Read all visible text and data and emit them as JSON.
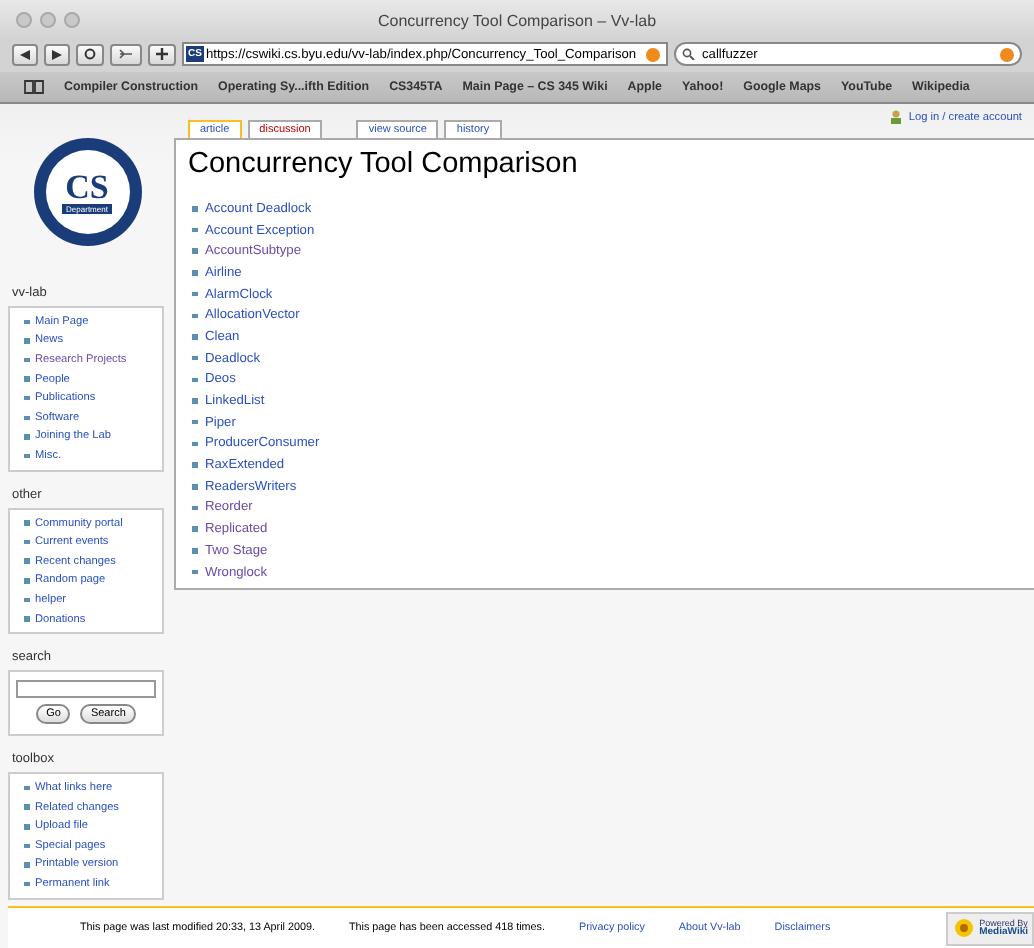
{
  "window": {
    "title": "Concurrency Tool Comparison – Vv-lab"
  },
  "toolbar": {
    "favicon": "CS",
    "address": "https://cswiki.cs.byu.edu/vv-lab/index.php/Concurrency_Tool_Comparison",
    "search": "callfuzzer"
  },
  "bookmarks": [
    "Compiler Construction",
    "Operating Sy...ifth Edition",
    "CS345TA",
    "Main Page – CS 345 Wiki",
    "Apple",
    "Yahoo!",
    "Google Maps",
    "YouTube",
    "Wikipedia"
  ],
  "user_link": "Log in / create account",
  "logo": {
    "text": "CS",
    "subtitle": "Department"
  },
  "tabs": [
    {
      "label": "article",
      "selected": true,
      "missing": false
    },
    {
      "label": "discussion",
      "selected": false,
      "missing": true
    },
    {
      "label": "view source",
      "selected": false,
      "missing": false
    },
    {
      "label": "history",
      "selected": false,
      "missing": false
    }
  ],
  "heading": "Concurrency Tool Comparison",
  "links": [
    {
      "label": "Account Deadlock",
      "visited": false
    },
    {
      "label": "Account Exception",
      "visited": false
    },
    {
      "label": "AccountSubtype",
      "visited": true
    },
    {
      "label": "Airline",
      "visited": false
    },
    {
      "label": "AlarmClock",
      "visited": false
    },
    {
      "label": "AllocationVector",
      "visited": false
    },
    {
      "label": "Clean",
      "visited": false
    },
    {
      "label": "Deadlock",
      "visited": false
    },
    {
      "label": "Deos",
      "visited": false
    },
    {
      "label": "LinkedList",
      "visited": false
    },
    {
      "label": "Piper",
      "visited": false
    },
    {
      "label": "ProducerConsumer",
      "visited": false
    },
    {
      "label": "RaxExtended",
      "visited": false
    },
    {
      "label": "ReadersWriters",
      "visited": false
    },
    {
      "label": "Reorder",
      "visited": true
    },
    {
      "label": "Replicated",
      "visited": true
    },
    {
      "label": "Two Stage",
      "visited": true
    },
    {
      "label": "Wronglock",
      "visited": true
    }
  ],
  "portlets": [
    {
      "kind": "links",
      "title": "vv-lab",
      "items": [
        {
          "label": "Main Page",
          "visited": false
        },
        {
          "label": "News",
          "visited": false
        },
        {
          "label": "Research Projects",
          "visited": true
        },
        {
          "label": "People",
          "visited": false
        },
        {
          "label": "Publications",
          "visited": false
        },
        {
          "label": "Software",
          "visited": false
        },
        {
          "label": "Joining the Lab",
          "visited": false
        },
        {
          "label": "Misc.",
          "visited": false
        }
      ]
    },
    {
      "kind": "links",
      "title": "other",
      "items": [
        {
          "label": "Community portal",
          "visited": false
        },
        {
          "label": "Current events",
          "visited": false
        },
        {
          "label": "Recent changes",
          "visited": false
        },
        {
          "label": "Random page",
          "visited": false
        },
        {
          "label": "helper",
          "visited": false
        },
        {
          "label": "Donations",
          "visited": false
        }
      ]
    },
    {
      "kind": "search",
      "title": "search",
      "buttons": [
        "Go",
        "Search"
      ]
    },
    {
      "kind": "links",
      "title": "toolbox",
      "items": [
        {
          "label": "What links here",
          "visited": false
        },
        {
          "label": "Related changes",
          "visited": false
        },
        {
          "label": "Upload file",
          "visited": false
        },
        {
          "label": "Special pages",
          "visited": false
        },
        {
          "label": "Printable version",
          "visited": false
        },
        {
          "label": "Permanent link",
          "visited": false
        }
      ]
    }
  ],
  "footer": {
    "texts": [
      "This page was last modified 20:33, 13 April 2009.",
      "This page has been accessed 418 times."
    ],
    "links": [
      "Privacy policy",
      "About Vv-lab",
      "Disclaimers"
    ],
    "badge": {
      "small": "Powered By",
      "name": "MediaWiki"
    }
  }
}
